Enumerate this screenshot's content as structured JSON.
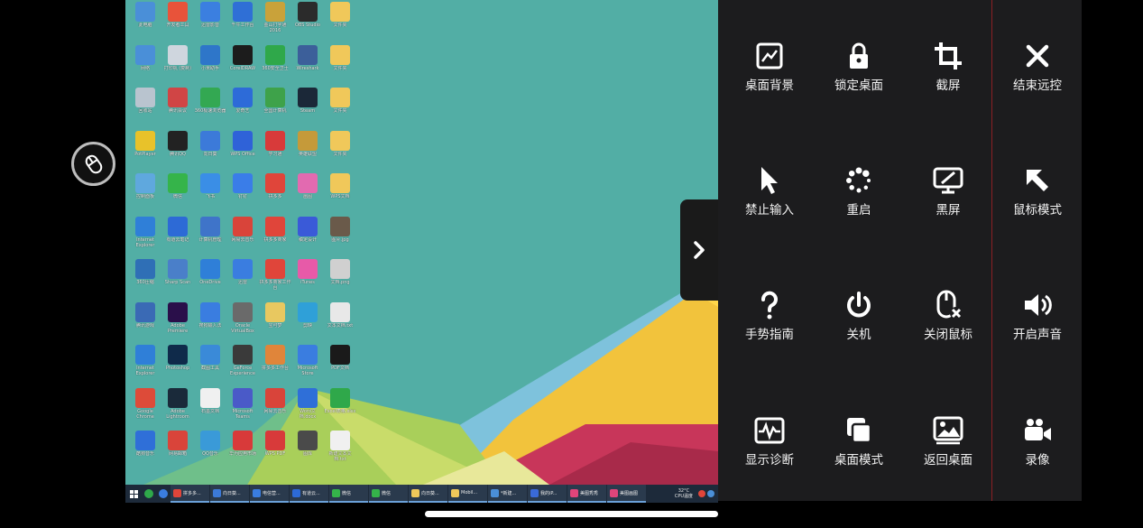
{
  "desktop": {
    "icons": [
      {
        "label": "此电脑",
        "color": "#4a8fd8"
      },
      {
        "label": "开发者工具",
        "color": "#e8533a"
      },
      {
        "label": "迅雷影音",
        "color": "#3b7fe0"
      },
      {
        "label": "千牛工作台",
        "color": "#2f6fd6"
      },
      {
        "label": "金山打字通 2016",
        "color": "#c9a23a"
      },
      {
        "label": "OBS Studio",
        "color": "#2b2b2b"
      },
      {
        "label": "文件夹",
        "color": "#f0c85a"
      },
      {
        "label": "网络",
        "color": "#4a8fd8"
      },
      {
        "label": "打印机 (复制)",
        "color": "#cfd6de"
      },
      {
        "label": "小米助手",
        "color": "#2e76c9"
      },
      {
        "label": "CorelDRAW",
        "color": "#1c1c1c"
      },
      {
        "label": "360安全卫士",
        "color": "#2fa84a"
      },
      {
        "label": "Wireshark",
        "color": "#3c5f9a"
      },
      {
        "label": "文件夹",
        "color": "#f0c85a"
      },
      {
        "label": "回收站",
        "color": "#b9c4cf"
      },
      {
        "label": "腾讯会议",
        "color": "#d04545"
      },
      {
        "label": "360极速浏览器",
        "color": "#33a852"
      },
      {
        "label": "爱奇艺",
        "color": "#2d6bd8"
      },
      {
        "label": "全国计算机",
        "color": "#3ea24a"
      },
      {
        "label": "Steam",
        "color": "#1b2838"
      },
      {
        "label": "文件夹",
        "color": "#f0c85a"
      },
      {
        "label": "PotPlayer",
        "color": "#e8c22a"
      },
      {
        "label": "腾讯QQ",
        "color": "#222222"
      },
      {
        "label": "向日葵",
        "color": "#3c7ad9"
      },
      {
        "label": "WPS Office",
        "color": "#2f62d8"
      },
      {
        "label": "学习通",
        "color": "#d83a3a"
      },
      {
        "label": "英雄联盟",
        "color": "#c59a3a"
      },
      {
        "label": "文件夹",
        "color": "#f0c85a"
      },
      {
        "label": "控制面板",
        "color": "#5fa8de"
      },
      {
        "label": "微信",
        "color": "#35b44a"
      },
      {
        "label": "飞书",
        "color": "#3a8ee6"
      },
      {
        "label": "钉钉",
        "color": "#3a7de8"
      },
      {
        "label": "拼多多",
        "color": "#e0453a"
      },
      {
        "label": "画图",
        "color": "#e26ab0"
      },
      {
        "label": "WPS文档",
        "color": "#f0c85a"
      },
      {
        "label": "Internet Explorer",
        "color": "#2f7fd8"
      },
      {
        "label": "有道云笔记",
        "color": "#2d6ad6"
      },
      {
        "label": "计算机管理",
        "color": "#3f74c9"
      },
      {
        "label": "网易云音乐",
        "color": "#d9443a"
      },
      {
        "label": "拼多多商家",
        "color": "#e0453a"
      },
      {
        "label": "稿定设计",
        "color": "#3a5ad8"
      },
      {
        "label": "图片.jpg",
        "color": "#6a5a4a"
      },
      {
        "label": "360压缩",
        "color": "#2f6fb6"
      },
      {
        "label": "Sharp Scan",
        "color": "#4a7fc9"
      },
      {
        "label": "OneDrive",
        "color": "#2f7fd8"
      },
      {
        "label": "迅雷",
        "color": "#3a7de0"
      },
      {
        "label": "拼多多商家工作台",
        "color": "#e0453a"
      },
      {
        "label": "iTunes",
        "color": "#e75aa8"
      },
      {
        "label": "文档.png",
        "color": "#d0d0d0"
      },
      {
        "label": "腾讯游戏",
        "color": "#3a6ab5"
      },
      {
        "label": "Adobe Premiere",
        "color": "#2a0f4a"
      },
      {
        "label": "搜狗输入法",
        "color": "#3a7de0"
      },
      {
        "label": "Oracle VirtualBox",
        "color": "#6a6a6a"
      },
      {
        "label": "宝可梦",
        "color": "#e8c860"
      },
      {
        "label": "剪映",
        "color": "#2fa0d8"
      },
      {
        "label": "文本文档.txt",
        "color": "#e8e8e8"
      },
      {
        "label": "Internet Explorer",
        "color": "#2f7fd8"
      },
      {
        "label": "Photoshop",
        "color": "#0f2a4a"
      },
      {
        "label": "截图工具",
        "color": "#3a8ad8"
      },
      {
        "label": "GeForce Experience",
        "color": "#3a3a3a"
      },
      {
        "label": "拼多多工作台",
        "color": "#e0853a"
      },
      {
        "label": "Microsoft Store",
        "color": "#3a7de0"
      },
      {
        "label": "PDF文档",
        "color": "#1a1a1a"
      },
      {
        "label": "Google Chrome",
        "color": "#dd4b39"
      },
      {
        "label": "Adobe Lightroom",
        "color": "#1a2a3a"
      },
      {
        "label": "石墨文档",
        "color": "#f0f0f0"
      },
      {
        "label": "Microsoft Teams",
        "color": "#4a5ac8"
      },
      {
        "label": "网易云音乐",
        "color": "#d9443a"
      },
      {
        "label": "Word文档.docx",
        "color": "#2f6fd8"
      },
      {
        "label": "Excel表格.xlsx",
        "color": "#2fa84a"
      },
      {
        "label": "酷狗音乐",
        "color": "#2f6fd8"
      },
      {
        "label": "网易邮箱",
        "color": "#d9443a"
      },
      {
        "label": "QQ音乐",
        "color": "#3a9ad8"
      },
      {
        "label": "华为应用市场",
        "color": "#d83a3a"
      },
      {
        "label": "WPS PDF",
        "color": "#d83a3a"
      },
      {
        "label": "图库",
        "color": "#4a4a4a"
      },
      {
        "label": "新建文本文档.txt",
        "color": "#f0f0f0"
      }
    ]
  },
  "taskbar": {
    "pinned_colors": [
      "#2fa84a",
      "#3a7de0"
    ],
    "apps": [
      {
        "label": "拼多多...",
        "color": "#e0453a"
      },
      {
        "label": "向日葵...",
        "color": "#3c7ad9"
      },
      {
        "label": "电信营...",
        "color": "#3a7de0"
      },
      {
        "label": "有道云...",
        "color": "#2d6ad6"
      },
      {
        "label": "微信",
        "color": "#35b44a"
      },
      {
        "label": "微信",
        "color": "#35b44a"
      },
      {
        "label": "向日葵...",
        "color": "#f0c85a"
      },
      {
        "label": "Mobil...",
        "color": "#f0c85a"
      },
      {
        "label": "*新建...",
        "color": "#4a8fd8"
      },
      {
        "label": "我的iP...",
        "color": "#3a6ad8"
      },
      {
        "label": "美图秀秀",
        "color": "#e0457a"
      },
      {
        "label": "美图画图",
        "color": "#e0457a"
      }
    ],
    "cpu_temp": "32°C",
    "cpu_label": "CPU温度"
  },
  "panel": {
    "buttons": [
      {
        "id": "desktop-bg",
        "label": "桌面背景",
        "icon": "image-chart-icon"
      },
      {
        "id": "lock-desktop",
        "label": "锁定桌面",
        "icon": "lock-icon"
      },
      {
        "id": "screenshot",
        "label": "截屏",
        "icon": "crop-icon"
      },
      {
        "id": "end-remote",
        "label": "结束远控",
        "icon": "close-icon"
      },
      {
        "id": "disable-input",
        "label": "禁止输入",
        "icon": "cursor-arrow-icon"
      },
      {
        "id": "restart",
        "label": "重启",
        "icon": "spinner-icon"
      },
      {
        "id": "black-screen",
        "label": "黑屏",
        "icon": "monitor-slash-icon"
      },
      {
        "id": "mouse-mode",
        "label": "鼠标模式",
        "icon": "arrow-up-left-icon"
      },
      {
        "id": "gesture-guide",
        "label": "手势指南",
        "icon": "question-icon"
      },
      {
        "id": "shutdown",
        "label": "关机",
        "icon": "power-icon"
      },
      {
        "id": "close-mouse",
        "label": "关闭鼠标",
        "icon": "mouse-off-icon"
      },
      {
        "id": "enable-sound",
        "label": "开启声音",
        "icon": "speaker-icon"
      },
      {
        "id": "display-diagnose",
        "label": "显示诊断",
        "icon": "waveform-icon"
      },
      {
        "id": "desktop-mode",
        "label": "桌面模式",
        "icon": "windows-stack-icon"
      },
      {
        "id": "return-desktop",
        "label": "返回桌面",
        "icon": "picture-icon"
      },
      {
        "id": "record",
        "label": "录像",
        "icon": "video-camera-icon"
      }
    ]
  },
  "colors": {
    "panel_bg": "#1c1c1e",
    "divider": "#8b1f24",
    "wallpaper_teal": "#52aea5"
  }
}
